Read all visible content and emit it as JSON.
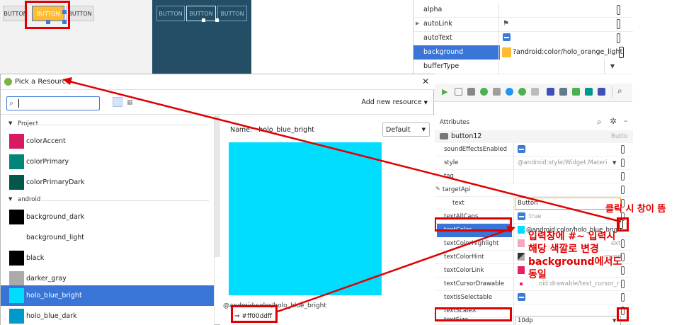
{
  "preview": {
    "buttons": [
      "BUTTON",
      "BUTTON",
      "BUTTON"
    ],
    "blueprint_buttons": [
      "BUTTON",
      "BUTTON",
      "BUTTON"
    ]
  },
  "top_attributes": [
    {
      "name": "alpha",
      "value": ""
    },
    {
      "name": "autoLink",
      "value": ""
    },
    {
      "name": "autoText",
      "value": ""
    },
    {
      "name": "background",
      "value": "?android:color/holo_orange_light"
    },
    {
      "name": "bufferType",
      "value": ""
    }
  ],
  "dialog": {
    "title": "Pick a Resource",
    "add_new_resource": "Add new resource",
    "sections": {
      "project": "Project",
      "android": "android"
    },
    "project_items": [
      {
        "label": "colorAccent",
        "color": "#d81b60"
      },
      {
        "label": "colorPrimary",
        "color": "#008577"
      },
      {
        "label": "colorPrimaryDark",
        "color": "#00574b"
      }
    ],
    "android_items": [
      {
        "label": "background_dark",
        "color": "#000000"
      },
      {
        "label": "background_light",
        "color": "#ffffff"
      },
      {
        "label": "black",
        "color": "#000000"
      },
      {
        "label": "darker_gray",
        "color": "#aaaaaa"
      },
      {
        "label": "holo_blue_bright",
        "color": "#00ddff"
      },
      {
        "label": "holo_blue_dark",
        "color": "#0099cc"
      }
    ],
    "preview_name": "Name:   holo_blue_bright",
    "preview_default": "Default",
    "preview_color": "#00ddff",
    "preview_path": "@android:color/holo_blue_bright",
    "preview_hex": "⇒ #ff00ddff"
  },
  "attributes_panel": {
    "header": "Attributes",
    "component": "button12",
    "component_type": "Butto",
    "rows": [
      {
        "name": "soundEffectsEnabled",
        "value": ""
      },
      {
        "name": "style",
        "value": "@android:style/Widget.Materi"
      },
      {
        "name": "tag",
        "value": ""
      },
      {
        "name": "targetApi",
        "value": ""
      },
      {
        "name": "text",
        "value": "Button"
      },
      {
        "name": "textAllCaps",
        "value": "true"
      },
      {
        "name": "textColor",
        "value": "@android:color/holo_blue_brigh"
      },
      {
        "name": "textColorHighlight",
        "value": "ext"
      },
      {
        "name": "textColorHint",
        "value": "round"
      },
      {
        "name": "textColorLink",
        "value": ""
      },
      {
        "name": "textCursorDrawable",
        "value": "oid:drawable/text_cursor_r"
      },
      {
        "name": "textIsSelectable",
        "value": ""
      },
      {
        "name": "textScaleX",
        "value": ""
      },
      {
        "name": "textSize",
        "value": "10dp"
      }
    ]
  },
  "annotations": {
    "click_note": "클릭 시 창이 뜸",
    "note_line1": "입력창에 #~ 입력시",
    "note_line2": "해당 색깔로 변경",
    "note_line3": "background에서도",
    "note_line4": "동일"
  },
  "colors": {
    "accent_red": "#e00000",
    "selection_blue": "#3875d7",
    "orange": "#ffbb33"
  }
}
